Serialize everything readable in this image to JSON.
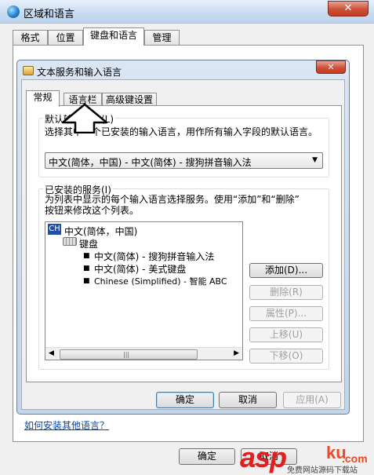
{
  "outer_window": {
    "title": "区域和语言",
    "close_glyph": "✕",
    "tabs": [
      "格式",
      "位置",
      "键盘和语言",
      "管理"
    ],
    "active_tab": "键盘和语言",
    "help_link": "如何安装其他语言？",
    "buttons": {
      "ok": "确定",
      "cancel": "取消"
    }
  },
  "dialog": {
    "title": "文本服务和输入语言",
    "close_glyph": "✕",
    "tabs": [
      "常规",
      "语言栏",
      "高级键设置"
    ],
    "active_tab": "常规",
    "default_language": {
      "group_label": "默认输入语言(L)",
      "description": "选择其中一个已安装的输入语言，用作所有输入字段的默认语言。",
      "selected": "中文(简体，中国) - 中文(简体) - 搜狗拼音输入法"
    },
    "installed_services": {
      "group_label": "已安装的服务(I)",
      "description_line1": "为列表中显示的每个输入语言选择服务。使用“添加”和“删除”",
      "description_line2": "按钮来修改这个列表。",
      "language_badge": "CH",
      "language_node": "中文(简体，中国)",
      "keyboard_node": "键盘",
      "items": [
        "中文(简体) - 搜狗拼音输入法",
        "中文(简体) - 美式键盘",
        "Chinese (Simplified) - 智能 ABC"
      ]
    },
    "side_buttons": {
      "add": "添加(D)...",
      "remove": "删除(R)",
      "properties": "属性(P)...",
      "move_up": "上移(U)",
      "move_down": "下移(O)"
    },
    "buttons": {
      "ok": "确定",
      "cancel": "取消",
      "apply": "应用(A)"
    }
  },
  "watermark": {
    "brand": "asp",
    "ku": "ku",
    "com": ".com",
    "caption": "免费网站源码下载站"
  },
  "colors": {
    "accent": "#3c7fb1",
    "close": "#cd4f37",
    "watermark": "#e02020"
  }
}
